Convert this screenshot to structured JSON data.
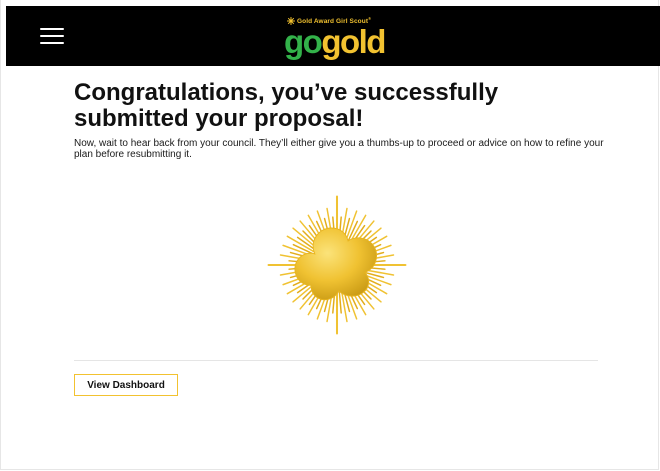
{
  "header": {
    "menu_icon": "hamburger-menu-icon",
    "logo": {
      "tagline": "Gold Award Girl Scout",
      "trademark": "®",
      "word_go": "go",
      "word_gold": "gold"
    },
    "background": "#000000"
  },
  "main": {
    "headline": "Congratulations, you’ve successfully submitted your proposal!",
    "message": "Now, wait to hear back from your council. They’ll either give you a thumbs-up to proceed or advice on how to refine your plan before resubmitting it.",
    "badge_icon": "gold-award-trefoil-badge-icon",
    "dashboard_button": "View Dashboard"
  },
  "colors": {
    "gold": "#f2c230",
    "green": "#33b24a",
    "text": "#111111",
    "divider": "#e5e5e5"
  }
}
